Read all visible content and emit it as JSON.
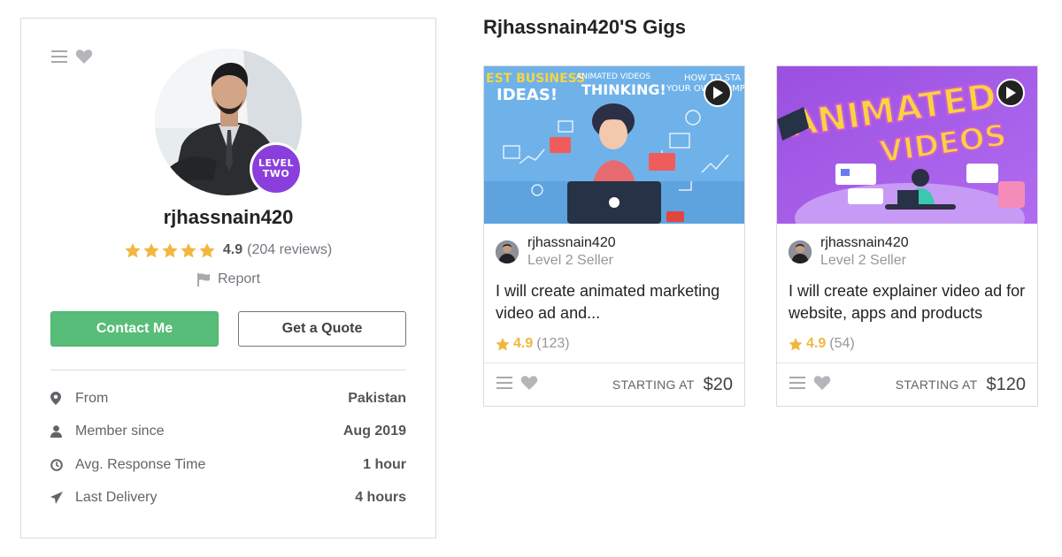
{
  "profile": {
    "username": "rjhassnain420",
    "level_badge": [
      "LEVEL",
      "TWO"
    ],
    "rating_score": "4.9",
    "rating_count": "(204 reviews)",
    "star_count": 5,
    "report_label": "Report",
    "contact_button": "Contact Me",
    "quote_button": "Get a Quote",
    "stats": [
      {
        "label": "From",
        "value": "Pakistan",
        "icon": "location-pin-icon"
      },
      {
        "label": "Member since",
        "value": "Aug 2019",
        "icon": "user-icon"
      },
      {
        "label": "Avg. Response Time",
        "value": "1 hour",
        "icon": "clock-icon"
      },
      {
        "label": "Last Delivery",
        "value": "4 hours",
        "icon": "paper-plane-icon"
      }
    ]
  },
  "gigs_section": {
    "title": "Rjhassnain420'S Gigs",
    "gigs": [
      {
        "thumbnail_texts": [
          "EST BUSINESS",
          "IDEAS!",
          "ANIMATED VIDEOS",
          "THINKING!",
          "HOW TO STA",
          "YOUR OWN COMPA"
        ],
        "seller_name": "rjhassnain420",
        "seller_level": "Level 2 Seller",
        "description": "I will create animated marketing video ad and...",
        "rating": "4.9",
        "rating_count": "(123)",
        "starting_at": "STARTING AT",
        "price": "$20"
      },
      {
        "thumbnail_texts": [
          "ANIMATED",
          "VIDEOS"
        ],
        "seller_name": "rjhassnain420",
        "seller_level": "Level 2 Seller",
        "description": "I will create explainer video ad for website, apps and products",
        "rating": "4.9",
        "rating_count": "(54)",
        "starting_at": "STARTING AT",
        "price": "$120"
      }
    ]
  },
  "colors": {
    "accent_green": "#57bd78",
    "level_purple": "#8a3fdc",
    "star_yellow": "#f1b73f",
    "border": "#dadbdd"
  }
}
